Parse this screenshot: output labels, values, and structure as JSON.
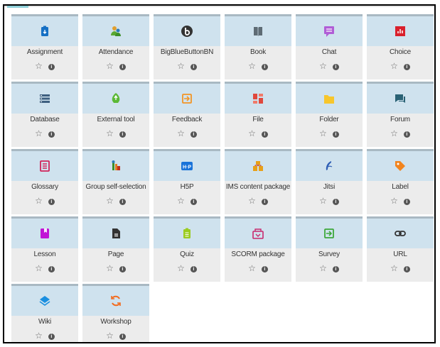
{
  "modules": [
    {
      "label": "Assignment",
      "icon": "assignment-icon",
      "color": "#1670c4"
    },
    {
      "label": "Attendance",
      "icon": "attendance-icon",
      "color": "#5aa832"
    },
    {
      "label": "BigBlueButtonBN",
      "icon": "bigbluebutton-icon",
      "color": "#333333"
    },
    {
      "label": "Book",
      "icon": "book-icon",
      "color": "#5e6b74"
    },
    {
      "label": "Chat",
      "icon": "chat-icon",
      "color": "#b05ed6"
    },
    {
      "label": "Choice",
      "icon": "choice-icon",
      "color": "#d9202c"
    },
    {
      "label": "Database",
      "icon": "database-icon",
      "color": "#3e5f7f"
    },
    {
      "label": "External tool",
      "icon": "external-tool-icon",
      "color": "#5bb936"
    },
    {
      "label": "Feedback",
      "icon": "feedback-icon",
      "color": "#f29525"
    },
    {
      "label": "File",
      "icon": "file-icon",
      "color": "#e0483d"
    },
    {
      "label": "Folder",
      "icon": "folder-icon",
      "color": "#f7c62c"
    },
    {
      "label": "Forum",
      "icon": "forum-icon",
      "color": "#2a6275"
    },
    {
      "label": "Glossary",
      "icon": "glossary-icon",
      "color": "#d0245b"
    },
    {
      "label": "Group self-selection",
      "icon": "group-self-selection-icon",
      "color": "#e07b1f"
    },
    {
      "label": "H5P",
      "icon": "h5p-icon",
      "color": "#1a73d9"
    },
    {
      "label": "IMS content package",
      "icon": "ims-package-icon",
      "color": "#e8a018"
    },
    {
      "label": "Jitsi",
      "icon": "jitsi-icon",
      "color": "#2f5fb5"
    },
    {
      "label": "Label",
      "icon": "label-icon",
      "color": "#f2841e"
    },
    {
      "label": "Lesson",
      "icon": "lesson-icon",
      "color": "#c113d6"
    },
    {
      "label": "Page",
      "icon": "page-icon",
      "color": "#333333"
    },
    {
      "label": "Quiz",
      "icon": "quiz-icon",
      "color": "#9bcc20"
    },
    {
      "label": "SCORM package",
      "icon": "scorm-package-icon",
      "color": "#c9286c"
    },
    {
      "label": "Survey",
      "icon": "survey-icon",
      "color": "#3da83a"
    },
    {
      "label": "URL",
      "icon": "url-icon",
      "color": "#333333"
    },
    {
      "label": "Wiki",
      "icon": "wiki-icon",
      "color": "#1a8fe0"
    },
    {
      "label": "Workshop",
      "icon": "workshop-icon",
      "color": "#f26b1e"
    }
  ],
  "star_glyph": "☆",
  "info_glyph": "i"
}
